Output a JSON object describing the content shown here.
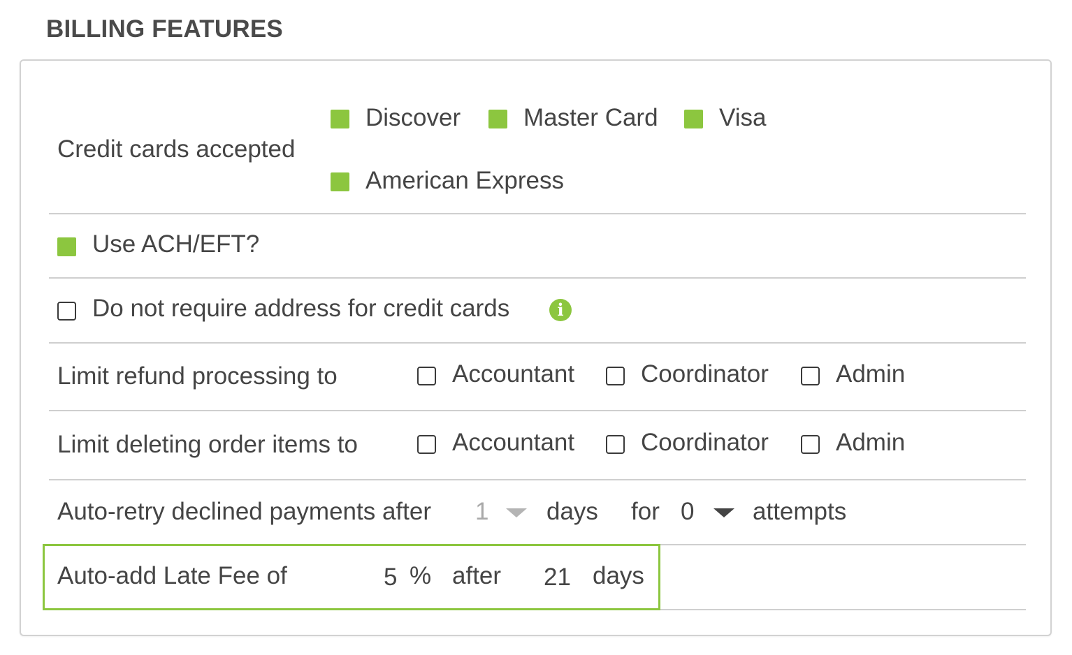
{
  "section": {
    "title": "BILLING FEATURES"
  },
  "colors": {
    "accent": "#8cc63f",
    "divider": "#cfcfcf",
    "text": "#454545"
  },
  "credit_cards": {
    "label": "Credit cards accepted",
    "options": [
      {
        "label": "Discover",
        "checked": true
      },
      {
        "label": "Master Card",
        "checked": true
      },
      {
        "label": "Visa",
        "checked": true
      },
      {
        "label": "American Express",
        "checked": true
      }
    ]
  },
  "ach": {
    "label": "Use ACH/EFT?",
    "checked": true
  },
  "no_address": {
    "label": "Do not require address for credit cards",
    "checked": false,
    "icon": "info-icon"
  },
  "refund_limit": {
    "label": "Limit refund processing to",
    "roles": [
      {
        "label": "Accountant",
        "checked": false
      },
      {
        "label": "Coordinator",
        "checked": false
      },
      {
        "label": "Admin",
        "checked": false
      }
    ]
  },
  "delete_limit": {
    "label": "Limit deleting order items to",
    "roles": [
      {
        "label": "Accountant",
        "checked": false
      },
      {
        "label": "Coordinator",
        "checked": false
      },
      {
        "label": "Admin",
        "checked": false
      }
    ]
  },
  "auto_retry": {
    "label": "Auto-retry declined payments after",
    "days_value": "1",
    "days_label": "days",
    "for_label": "for",
    "attempts_value": "0",
    "attempts_label": "attempts"
  },
  "late_fee": {
    "label": "Auto-add Late Fee of",
    "percent_value": "5",
    "percent_symbol": "%",
    "after_label": "after",
    "days_value": "21",
    "days_label": "days"
  }
}
